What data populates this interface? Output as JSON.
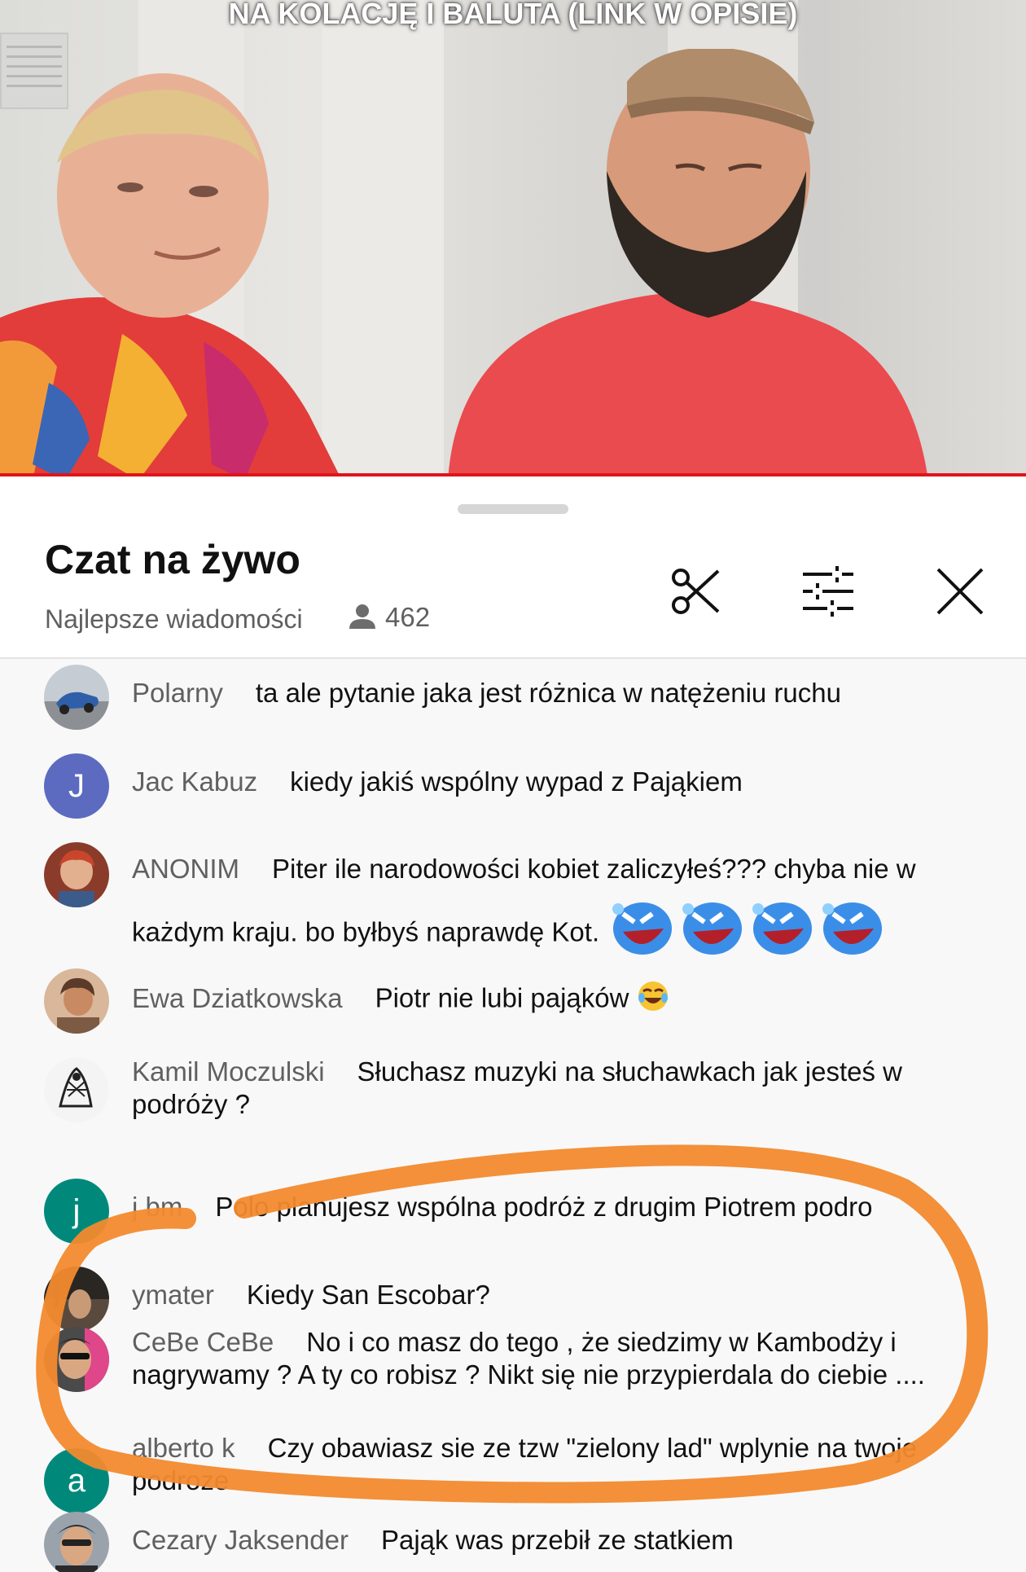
{
  "video": {
    "caption": "NA KOLACJĘ I BALUTA (LINK W OPISIE)",
    "progress_color": "#e0141a"
  },
  "chat": {
    "title": "Czat na żywo",
    "mode": "Najlepsze wiadomości",
    "viewer_count": "462",
    "icons": [
      "person-icon",
      "scissors-icon",
      "sliders-icon",
      "close-icon"
    ]
  },
  "messages": [
    {
      "author": "Polarny",
      "text": "ta ale pytanie jaka jest różnica w natężeniu ruchu",
      "avatar": "photo"
    },
    {
      "author": "Jac Kabuz",
      "text": "kiedy jakiś wspólny wypad z Pająkiem",
      "avatar_letter": "J",
      "avatar_color": "#5c6bc0"
    },
    {
      "author": "ANONIM",
      "text": "Piter ile narodowości kobiet zaliczyłeś??? chyba nie w każdym kraju. bo byłbyś naprawdę Kot.",
      "avatar": "photo",
      "emojis": [
        "rofl-emoji",
        "rofl-emoji",
        "rofl-emoji",
        "rofl-emoji"
      ]
    },
    {
      "author": "Ewa Dziatkowska",
      "text": "Piotr nie lubi pająków",
      "avatar": "photo",
      "emojis": [
        "tears-of-joy-emoji"
      ]
    },
    {
      "author": "Kamil Moczulski",
      "text": "Słuchasz muzyki na słuchawkach jak jesteś w podróży ?",
      "avatar": "photo"
    },
    {
      "author": "j bm",
      "text": "Polo planujesz wspólna podróż z drugim Piotrem podro",
      "avatar_letter": "j",
      "avatar_color": "#00897b"
    },
    {
      "author": "ymater",
      "text": "Kiedy San Escobar?",
      "avatar": "photo"
    },
    {
      "author": "CeBe CeBe",
      "text": "No i co masz do tego , że siedzimy w Kambodży i nagrywamy ? A ty co robisz ? Nikt się nie przypierdala do ciebie ....",
      "avatar": "photo"
    },
    {
      "author": "alberto k",
      "text": "Czy obawiasz sie ze tzw \"zielony lad\" wplynie na twoje podroze",
      "avatar_letter": "a",
      "avatar_color": "#00897b"
    },
    {
      "author": "Cezary Jaksender",
      "text": "Pająk was przebił ze statkiem",
      "avatar": "photo"
    }
  ],
  "annotation_color": "#f28a2e"
}
